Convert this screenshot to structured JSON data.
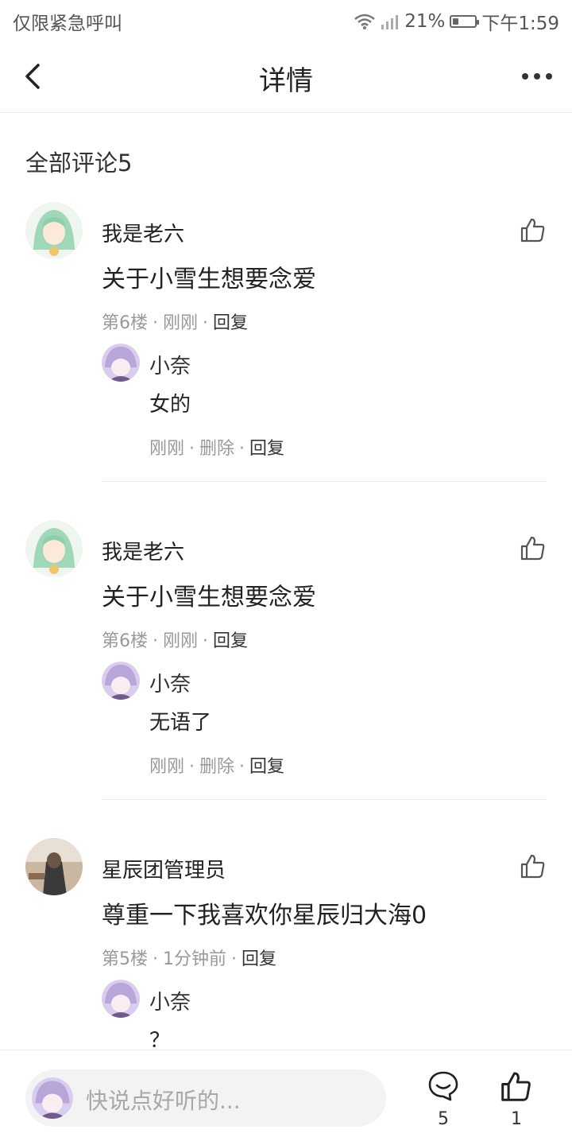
{
  "status_bar": {
    "left_text": "仅限紧急呼叫",
    "battery": "21%",
    "time": "下午1:59"
  },
  "header": {
    "title": "详情"
  },
  "section": {
    "title": "全部评论5"
  },
  "comments": [
    {
      "user": "我是老六",
      "text": "关于小雪生想要念爱",
      "floor": "第6楼",
      "time": "刚刚",
      "reply_label": "回复",
      "reply": {
        "user": "小奈",
        "text": "女的",
        "time": "刚刚",
        "delete_label": "删除",
        "reply_label": "回复"
      }
    },
    {
      "user": "我是老六",
      "text": "关于小雪生想要念爱",
      "floor": "第6楼",
      "time": "刚刚",
      "reply_label": "回复",
      "reply": {
        "user": "小奈",
        "text": "无语了",
        "time": "刚刚",
        "delete_label": "删除",
        "reply_label": "回复"
      }
    },
    {
      "user": "星辰团管理员",
      "text": "尊重一下我喜欢你星辰归大海0",
      "floor": "第5楼",
      "time": "1分钟前",
      "reply_label": "回复",
      "reply": {
        "user": "小奈",
        "text": "？"
      }
    }
  ],
  "bottom_bar": {
    "placeholder": "快说点好听的...",
    "comment_count": "5",
    "like_count": "1"
  },
  "colors": {
    "accent_avatar_purple": "#b8a6d9",
    "avatar_green": "#9fd8b8",
    "text_primary": "#222222",
    "text_meta": "#999999"
  }
}
